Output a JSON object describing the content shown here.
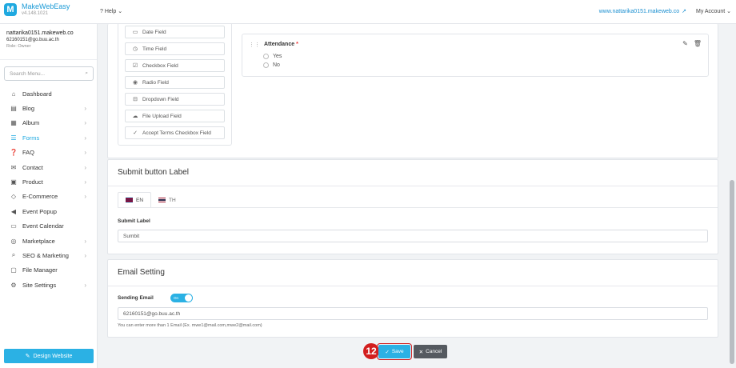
{
  "app": {
    "logo_letter": "M",
    "name": "MakeWebEasy",
    "version": "v4.148.1021"
  },
  "topbar": {
    "help_label": "Help",
    "site_url": "www.nattarika0151.makeweb.co",
    "account_label": "My Account"
  },
  "user": {
    "name": "nattarika0151.makeweb.co",
    "email": "62160151@go.buu.ac.th",
    "role": "Role: Owner"
  },
  "search": {
    "placeholder": "Search Menu..."
  },
  "menu": [
    {
      "label": "Dashboard",
      "icon": "home-icon",
      "glyph": "⌂",
      "chev": ""
    },
    {
      "label": "Blog",
      "icon": "blog-icon",
      "glyph": "▤",
      "chev": "›"
    },
    {
      "label": "Album",
      "icon": "album-icon",
      "glyph": "▦",
      "chev": "›"
    },
    {
      "label": "Forms",
      "icon": "forms-icon",
      "glyph": "☰",
      "chev": "›",
      "active": true
    },
    {
      "label": "FAQ",
      "icon": "faq-icon",
      "glyph": "❓",
      "chev": "›"
    },
    {
      "label": "Contact",
      "icon": "contact-icon",
      "glyph": "✉",
      "chev": "›"
    },
    {
      "label": "Product",
      "icon": "product-icon",
      "glyph": "▣",
      "chev": "›"
    },
    {
      "label": "E-Commerce",
      "icon": "tag-icon",
      "glyph": "◇",
      "chev": "›"
    },
    {
      "label": "Event Popup",
      "icon": "megaphone-icon",
      "glyph": "◀",
      "chev": ""
    },
    {
      "label": "Event Calendar",
      "icon": "calendar-icon",
      "glyph": "▭",
      "chev": ""
    },
    {
      "label": "Marketplace",
      "icon": "marketplace-icon",
      "glyph": "◎",
      "chev": "›"
    },
    {
      "label": "SEO & Marketing",
      "icon": "seo-icon",
      "glyph": "⌕",
      "chev": "›"
    },
    {
      "label": "File Manager",
      "icon": "folder-icon",
      "glyph": "▢",
      "chev": ""
    },
    {
      "label": "Site Settings",
      "icon": "gear-icon",
      "glyph": "⚙",
      "chev": "›"
    }
  ],
  "design_button": "Design Website",
  "field_types": [
    {
      "label": "Date Field",
      "icon": "calendar-icon",
      "glyph": "▭"
    },
    {
      "label": "Time Field",
      "icon": "clock-icon",
      "glyph": "◷"
    },
    {
      "label": "Checkbox Field",
      "icon": "checkbox-icon",
      "glyph": "☑"
    },
    {
      "label": "Radio Field",
      "icon": "radio-icon",
      "glyph": "◉"
    },
    {
      "label": "Dropdown Field",
      "icon": "dropdown-icon",
      "glyph": "⊟"
    },
    {
      "label": "File Upload Field",
      "icon": "upload-icon",
      "glyph": "☁"
    },
    {
      "label": "Accept Terms Checkbox Field",
      "icon": "check-icon",
      "glyph": "✓"
    }
  ],
  "preview_field": {
    "label": "Attendance",
    "required_mark": "*",
    "options": [
      "Yes",
      "No"
    ]
  },
  "submit_section": {
    "title": "Submit button Label",
    "tabs": [
      {
        "label": "EN"
      },
      {
        "label": "TH"
      }
    ],
    "field_label": "Submit Label",
    "value": "Sumbit"
  },
  "email_section": {
    "title": "Email Setting",
    "toggle_label": "Sending Email",
    "toggle_state": "On",
    "email_value": "62160151@go.buu.ac.th",
    "hint": "You can enter more than 1 Email (Ex. mwe1@mail.com,mwe2@mail.com)"
  },
  "actions": {
    "step_number": "12",
    "save_label": "Save",
    "cancel_label": "Cancel"
  },
  "colors": {
    "accent": "#2bb1e4",
    "highlight": "#d21e1e",
    "cancel": "#555a60"
  }
}
